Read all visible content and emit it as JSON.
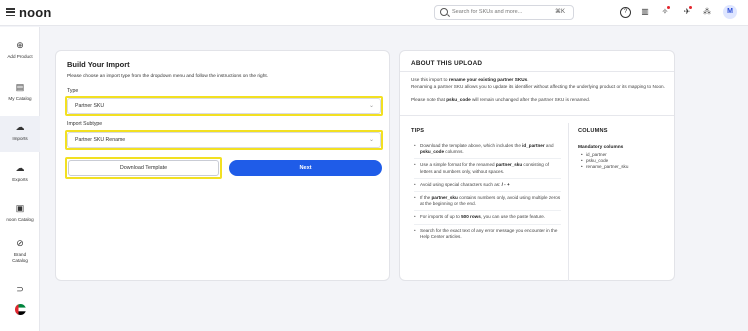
{
  "topbar": {
    "logo": "noon",
    "search_placeholder": "Search for SKUs and more...",
    "shortcut": "⌘K",
    "avatar": "M",
    "icons": [
      "help-icon",
      "grid-icon",
      "rocket-icon",
      "megaphone-icon",
      "translate-icon"
    ]
  },
  "sidebar": {
    "items": [
      {
        "label": "Add Product",
        "icon": "plus-circle-icon"
      },
      {
        "label": "My Catalog",
        "icon": "catalog-icon"
      },
      {
        "label": "Imports",
        "icon": "cloud-upload-icon"
      },
      {
        "label": "Exports",
        "icon": "cloud-download-icon"
      },
      {
        "label": "noon Catalog",
        "icon": "book-icon"
      },
      {
        "label": "Brand Catalog",
        "icon": "verified-icon"
      },
      {
        "label": "",
        "icon": "tag-icon"
      },
      {
        "label": "",
        "icon": "uae-flag-icon"
      }
    ]
  },
  "build": {
    "title": "Build Your Import",
    "instructions": "Please choose an import type from the dropdown menu and follow the instructions on the right.",
    "type_label": "Type",
    "type_value": "Partner SKU",
    "subtype_label": "Import Subtype",
    "subtype_value": "Partner SKU Rename",
    "download_label": "Download Template",
    "next_label": "Next"
  },
  "about": {
    "title": "ABOUT THIS UPLOAD",
    "line1_pre": "Use this import to ",
    "line1_bold": "rename your existing partner SKUs",
    "line1_post": ".",
    "line2": "Renaming a partner SKU allows you to update its identifier without affecting the underlying product or its mapping to Noon.",
    "line3_pre": "Please note that ",
    "line3_bold": "psku_code",
    "line3_post": " will remain unchanged after the partner SKU is renamed.",
    "tips_title": "TIPS",
    "tips": [
      {
        "pre": "Download the template above, which includes the ",
        "b1": "id_partner",
        "mid": " and ",
        "b2": "psku_code",
        "post": " columns."
      },
      {
        "pre": "Use a simple format for the renamed ",
        "b1": "partner_sku",
        "mid": " consisting of letters and numbers only, without spaces.",
        "b2": "",
        "post": ""
      },
      {
        "pre": "Avoid using special characters such as: ",
        "b1": "/ - +",
        "mid": "",
        "b2": "",
        "post": ""
      },
      {
        "pre": "If the ",
        "b1": "partner_sku",
        "mid": " contains numbers only, avoid using multiple zeros at the beginning or the end.",
        "b2": "",
        "post": ""
      },
      {
        "pre": "For imports of up to ",
        "b1": "500 rows",
        "mid": ", you can use the paste feature.",
        "b2": "",
        "post": ""
      },
      {
        "pre": "Search for the exact text of any error message you encounter in the Help Center articles.",
        "b1": "",
        "mid": "",
        "b2": "",
        "post": ""
      }
    ],
    "columns_title": "COLUMNS",
    "mandatory_label": "Mandatory columns",
    "columns": [
      "id_partner",
      "psku_code",
      "rename_partner_sku"
    ]
  },
  "colors": {
    "accent": "#1f5ce8",
    "highlight": "#f2e022"
  }
}
